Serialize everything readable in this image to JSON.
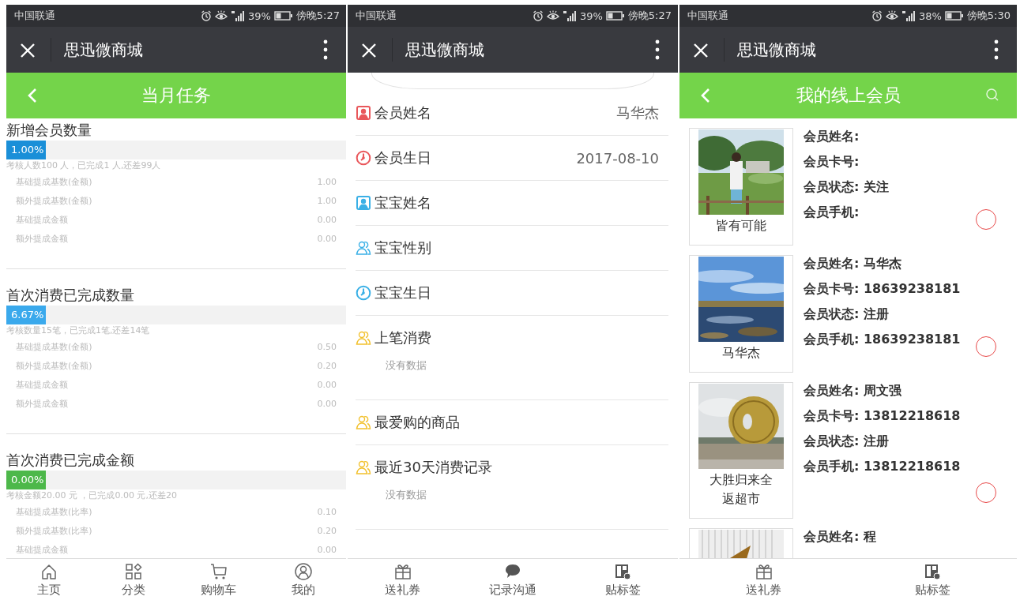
{
  "phones": [
    {
      "kind": "tasks",
      "status_bar": {
        "carrier": "中国联通",
        "battery": "39%",
        "time": "傍晚5:27"
      },
      "app_bar": {
        "title": "思迅微商城"
      },
      "header": {
        "title": "当月任务",
        "search": false
      },
      "tasks": [
        {
          "title": "新增会员数量",
          "percent": "1.00%",
          "color": "#1a8fd8",
          "summary": "考核人数100 人，已完成1 人,还差99人",
          "rows": [
            {
              "label": "基础提成基数(金额)",
              "value": "1.00"
            },
            {
              "label": "额外提成基数(金额)",
              "value": "1.00"
            },
            {
              "label": "基础提成金额",
              "value": "0.00"
            },
            {
              "label": "额外提成金额",
              "value": "0.00"
            }
          ]
        },
        {
          "title": "首次消费已完成数量",
          "percent": "6.67%",
          "color": "#3aa9ec",
          "summary": "考核数量15笔，已完成1笔,还差14笔",
          "rows": [
            {
              "label": "基础提成基数(金额)",
              "value": "0.50"
            },
            {
              "label": "额外提成基数(金额)",
              "value": "0.20"
            },
            {
              "label": "基础提成金额",
              "value": "0.00"
            },
            {
              "label": "额外提成金额",
              "value": "0.00"
            }
          ]
        },
        {
          "title": "首次消费已完成金额",
          "percent": "0.00%",
          "color": "#4db84a",
          "summary": "考核金额20.00 元 ，已完成0.00 元,还差20",
          "rows": [
            {
              "label": "基础提成基数(比率)",
              "value": "0.10"
            },
            {
              "label": "额外提成基数(比率)",
              "value": "0.20"
            },
            {
              "label": "基础提成金额",
              "value": "0.00"
            }
          ]
        }
      ],
      "nav": [
        {
          "label": "主页",
          "kind": "home"
        },
        {
          "label": "分类",
          "kind": "grid"
        },
        {
          "label": "购物车",
          "kind": "cart"
        },
        {
          "label": "我的",
          "kind": "user"
        }
      ]
    },
    {
      "kind": "member_detail",
      "status_bar": {
        "carrier": "中国联通",
        "battery": "39%",
        "time": "傍晚5:27"
      },
      "app_bar": {
        "title": "思迅微商城"
      },
      "fields": [
        {
          "label": "会员姓名",
          "value": "马华杰",
          "kind": "person",
          "color": "#e9575b"
        },
        {
          "label": "会员生日",
          "value": "2017-08-10",
          "kind": "clock",
          "color": "#e9575b"
        },
        {
          "label": "宝宝姓名",
          "kind": "person",
          "color": "#3ab0e6"
        },
        {
          "label": "宝宝性别",
          "kind": "group",
          "color": "#3ab0e6"
        },
        {
          "label": "宝宝生日",
          "kind": "clock",
          "color": "#3ab0e6"
        },
        {
          "label": "上笔消费",
          "kind": "group",
          "color": "#f2c12e",
          "note": "没有数据"
        },
        {
          "label": "最爱购的商品",
          "kind": "group",
          "color": "#f2c12e"
        },
        {
          "label": "最近30天消费记录",
          "kind": "group",
          "color": "#f2c12e",
          "note": "没有数据"
        }
      ],
      "nav": [
        {
          "label": "送礼券",
          "kind": "gift"
        },
        {
          "label": "记录沟通",
          "kind": "chat"
        },
        {
          "label": "贴标签",
          "kind": "tag"
        }
      ]
    },
    {
      "kind": "member_list",
      "status_bar": {
        "carrier": "中国联通",
        "battery": "38%",
        "time": "傍晚5:30"
      },
      "app_bar": {
        "title": "思迅微商城"
      },
      "header": {
        "title": "我的线上会员",
        "search": true
      },
      "members": [
        {
          "caption": "皆有可能",
          "lines": [
            "会员姓名:",
            "会员卡号:",
            "会员状态: 关注",
            "会员手机:"
          ],
          "selected": false
        },
        {
          "caption": "马华杰",
          "lines": [
            "会员姓名: 马华杰",
            "会员卡号: 18639238181",
            "会员状态: 注册",
            "会员手机: 18639238181"
          ],
          "selected": false
        },
        {
          "caption": "大胜归来全返超市",
          "lines": [
            "会员姓名: 周文强",
            "会员卡号: 13812218618",
            "会员状态: 注册",
            "会员手机: 13812218618"
          ],
          "selected": false
        },
        {
          "lines": [
            "会员姓名: 程"
          ]
        }
      ],
      "nav": [
        {
          "label": "送礼券",
          "kind": "gift"
        },
        {
          "label": "贴标签",
          "kind": "tag"
        }
      ]
    }
  ]
}
